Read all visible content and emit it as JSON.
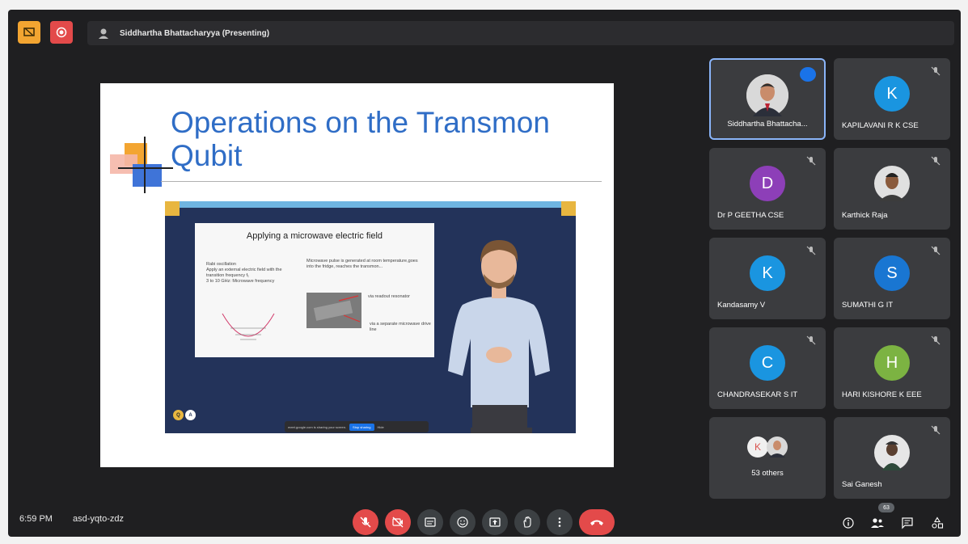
{
  "top_bar": {
    "presenting_label": "Siddhartha Bhattacharyya (Presenting)"
  },
  "slide": {
    "title_line1": "Operations on the Transmon",
    "title_line2": "Qubit",
    "inner_title": "Applying a microwave electric field",
    "inner_bullets": [
      "Rabi oscillation",
      "Apply an external electric field with the transition frequency f₁",
      "3 to 10 GHz: Microwave frequency"
    ],
    "inner_right_text": "Microwave pulse is generated at room temperature,goes into the fridge, reaches the transmon...",
    "inner_label1": "via readout resonator",
    "inner_label2": "via a separate microwave drive line",
    "share_notice": "meet.google.com is sharing your screen.",
    "share_stop": "Stop sharing",
    "share_hide": "Hide",
    "logo_q": "Q",
    "logo_a": "A"
  },
  "participants": [
    {
      "name": "Siddhartha Bhattacha...",
      "initial": "",
      "color": "",
      "active": true
    },
    {
      "name": "KAPILAVANI R K CSE",
      "initial": "K",
      "color": "#1a95e0"
    },
    {
      "name": "Dr P GEETHA CSE",
      "initial": "D",
      "color": "#8d3fb8"
    },
    {
      "name": "Karthick Raja",
      "initial": "",
      "color": ""
    },
    {
      "name": "Kandasamy V",
      "initial": "K",
      "color": "#1a95e0"
    },
    {
      "name": "SUMATHI G IT",
      "initial": "S",
      "color": "#1976d2"
    },
    {
      "name": "CHANDRASEKAR S IT",
      "initial": "C",
      "color": "#1a95e0"
    },
    {
      "name": "HARI KISHORE K EEE",
      "initial": "H",
      "color": "#7cb342"
    },
    {
      "name": "53 others",
      "initial": "",
      "color": ""
    },
    {
      "name": "Sai Ganesh",
      "initial": "",
      "color": ""
    }
  ],
  "bottom_bar": {
    "time": "6:59 PM",
    "meeting_code": "asd-yqto-zdz",
    "participant_count": "63"
  },
  "icons": [
    "present-icon",
    "record-icon",
    "mic-off-icon",
    "camera-off-icon",
    "captions-icon",
    "emoji-icon",
    "present-now-icon",
    "raise-hand-icon",
    "more-options-icon",
    "hang-up-icon",
    "info-icon",
    "people-icon",
    "chat-icon",
    "activities-icon"
  ]
}
